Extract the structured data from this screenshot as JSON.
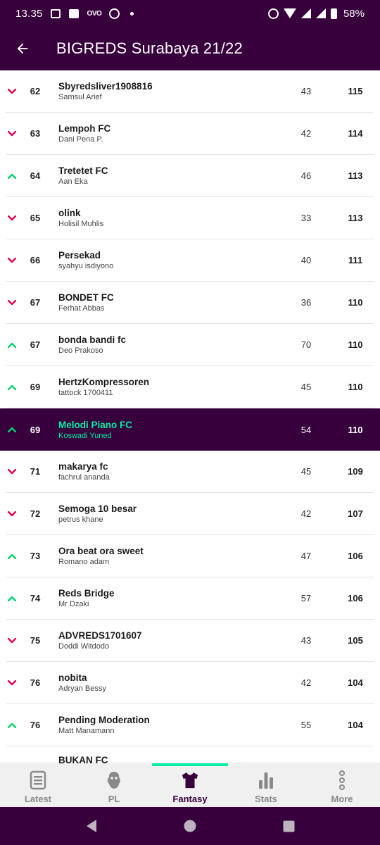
{
  "status_bar": {
    "time": "13.35",
    "left_icons": [
      "news-icon",
      "photo-icon",
      "ovo-icon",
      "whatsapp-icon",
      "dot-icon"
    ],
    "ovo_text": "OVO",
    "battery": "58%"
  },
  "app_bar": {
    "title": "BIGREDS Surabaya 21/22"
  },
  "rows": [
    {
      "rank": "62",
      "team": "Sbyredsliver1908816",
      "manager": "Samsul Arief",
      "gw": "43",
      "total": "115",
      "move": "down"
    },
    {
      "rank": "63",
      "team": "Lempoh FC",
      "manager": "Dani Pena P.",
      "gw": "42",
      "total": "114",
      "move": "down"
    },
    {
      "rank": "64",
      "team": "Tretetet FC",
      "manager": "Aan Eka",
      "gw": "46",
      "total": "113",
      "move": "up"
    },
    {
      "rank": "65",
      "team": "olink",
      "manager": "Holisil Muhlis",
      "gw": "33",
      "total": "113",
      "move": "down"
    },
    {
      "rank": "66",
      "team": "Persekad",
      "manager": "syahyu isdiyono",
      "gw": "40",
      "total": "111",
      "move": "down"
    },
    {
      "rank": "67",
      "team": "BONDET FC",
      "manager": "Ferhat Abbas",
      "gw": "36",
      "total": "110",
      "move": "down"
    },
    {
      "rank": "67",
      "team": "bonda bandi fc",
      "manager": "Deo Prakoso",
      "gw": "70",
      "total": "110",
      "move": "up"
    },
    {
      "rank": "69",
      "team": "HertzKompressoren",
      "manager": "tattock 1700411",
      "gw": "45",
      "total": "110",
      "move": "up"
    },
    {
      "rank": "69",
      "team": "Melodi Piano FC",
      "manager": "Koswadi Yuned",
      "gw": "54",
      "total": "110",
      "move": "up",
      "highlight": true
    },
    {
      "rank": "71",
      "team": "makarya fc",
      "manager": "fachrul ananda",
      "gw": "45",
      "total": "109",
      "move": "down"
    },
    {
      "rank": "72",
      "team": "Semoga 10 besar",
      "manager": "petrus khane",
      "gw": "42",
      "total": "107",
      "move": "down"
    },
    {
      "rank": "73",
      "team": "Ora beat ora sweet",
      "manager": "Romano adam",
      "gw": "47",
      "total": "106",
      "move": "up"
    },
    {
      "rank": "74",
      "team": "Reds Bridge",
      "manager": "Mr Dzaki",
      "gw": "57",
      "total": "106",
      "move": "up"
    },
    {
      "rank": "75",
      "team": "ADVREDS1701607",
      "manager": "Doddi Witdodo",
      "gw": "43",
      "total": "105",
      "move": "down"
    },
    {
      "rank": "76",
      "team": "nobita",
      "manager": "Adryan Bessy",
      "gw": "42",
      "total": "104",
      "move": "down"
    },
    {
      "rank": "76",
      "team": "Pending Moderation",
      "manager": "Matt Manamann",
      "gw": "55",
      "total": "104",
      "move": "up"
    }
  ],
  "partial_row": {
    "team": "BUKAN FC"
  },
  "bottom_nav": [
    {
      "label": "Latest",
      "icon": "latest-icon"
    },
    {
      "label": "PL",
      "icon": "pl-lion-icon"
    },
    {
      "label": "Fantasy",
      "icon": "fantasy-shirt-icon",
      "active": true
    },
    {
      "label": "Stats",
      "icon": "stats-icon"
    },
    {
      "label": "More",
      "icon": "more-icon"
    }
  ],
  "colors": {
    "brand": "#37003c",
    "accent": "#05f0a5",
    "down": "#e90052",
    "up": "#00d36b",
    "nav_inactive": "#8a8a8a"
  }
}
